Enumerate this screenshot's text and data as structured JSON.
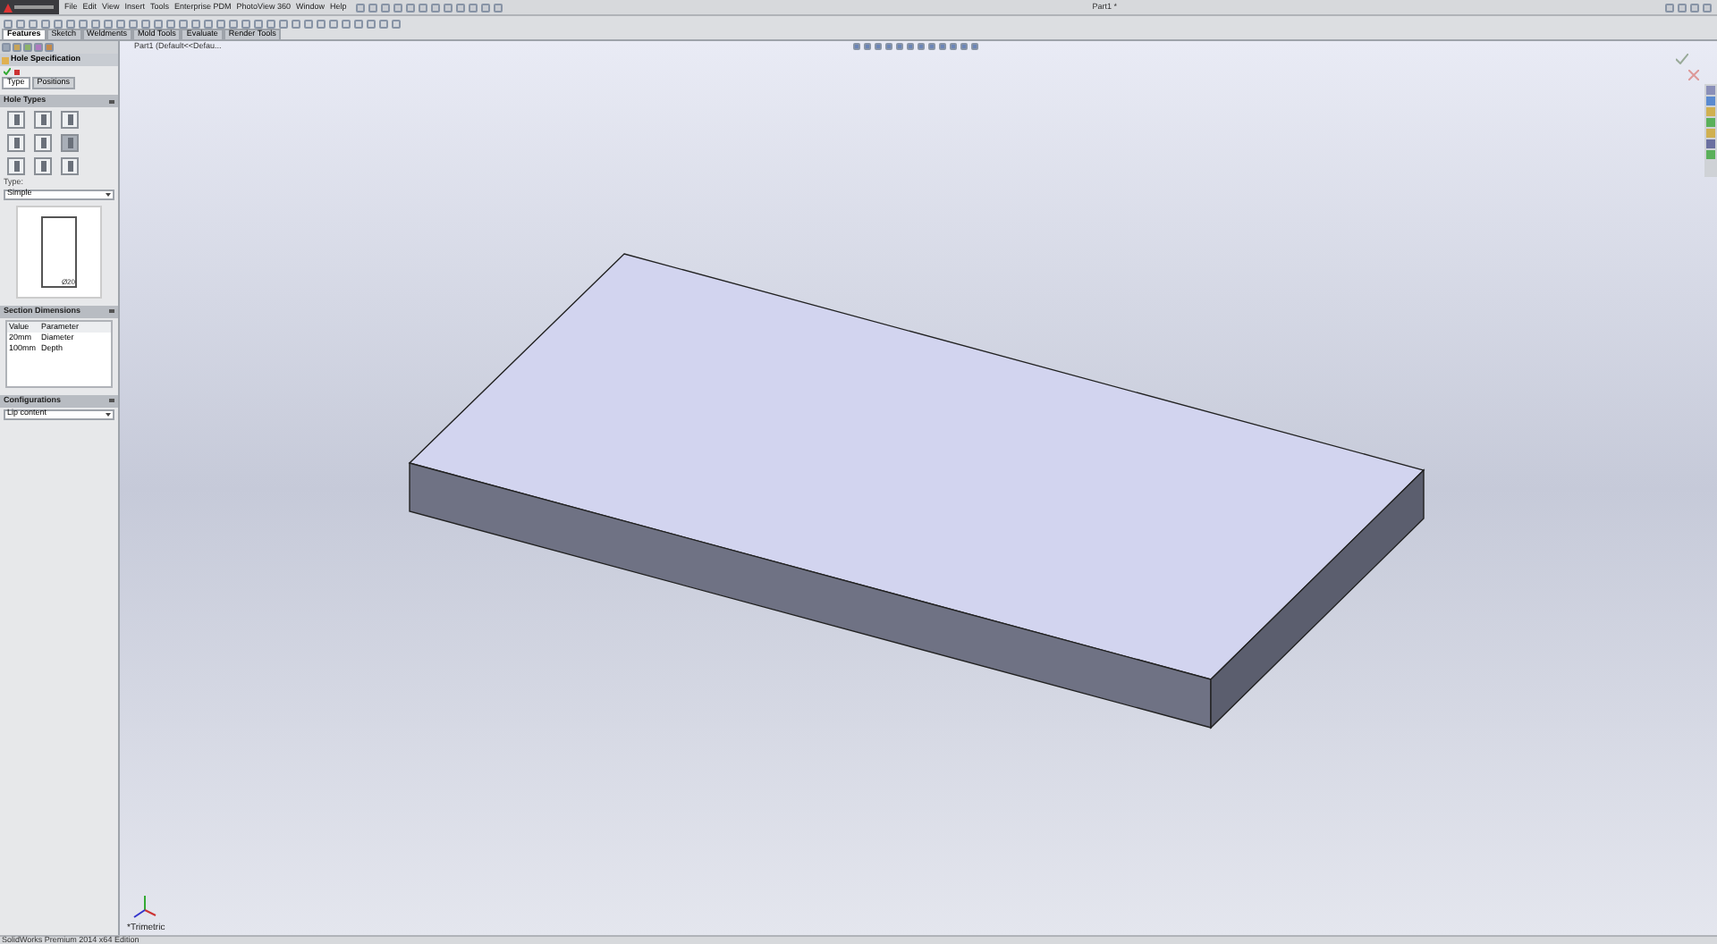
{
  "window": {
    "title": "Part1 *"
  },
  "menu": [
    "File",
    "Edit",
    "View",
    "Insert",
    "Tools",
    "Enterprise PDM",
    "PhotoView 360",
    "Window",
    "Help"
  ],
  "command_tabs": [
    {
      "label": "Features",
      "selected": true
    },
    {
      "label": "Sketch",
      "selected": false
    },
    {
      "label": "Weldments",
      "selected": false
    },
    {
      "label": "Mold Tools",
      "selected": false
    },
    {
      "label": "Evaluate",
      "selected": false
    },
    {
      "label": "Render Tools",
      "selected": false
    }
  ],
  "feature_tree": {
    "root": "Part1  (Default<<Defau..."
  },
  "property_manager": {
    "title": "Hole Specification",
    "tabs": [
      {
        "label": "Type",
        "selected": true
      },
      {
        "label": "Positions",
        "selected": false
      }
    ],
    "hole_types": {
      "title": "Hole Types",
      "items": [
        {
          "selected": false
        },
        {
          "selected": false
        },
        {
          "selected": false
        },
        {
          "selected": false
        },
        {
          "selected": false
        },
        {
          "selected": true
        },
        {
          "selected": false
        },
        {
          "selected": false
        },
        {
          "selected": false
        }
      ],
      "type_label": "Type:",
      "type_value": "Simple",
      "preview_label": "Ø20"
    },
    "section_dimensions": {
      "title": "Section Dimensions",
      "columns": [
        "Value",
        "Parameter"
      ],
      "rows": [
        [
          "20mm",
          "Diameter"
        ],
        [
          "100mm",
          "Depth"
        ]
      ]
    },
    "configurations": {
      "title": "Configurations",
      "value": "Lip content"
    }
  },
  "viewport": {
    "view_label": "*Trimetric"
  },
  "status_bar": {
    "text": "SolidWorks Premium 2014 x64 Edition"
  }
}
